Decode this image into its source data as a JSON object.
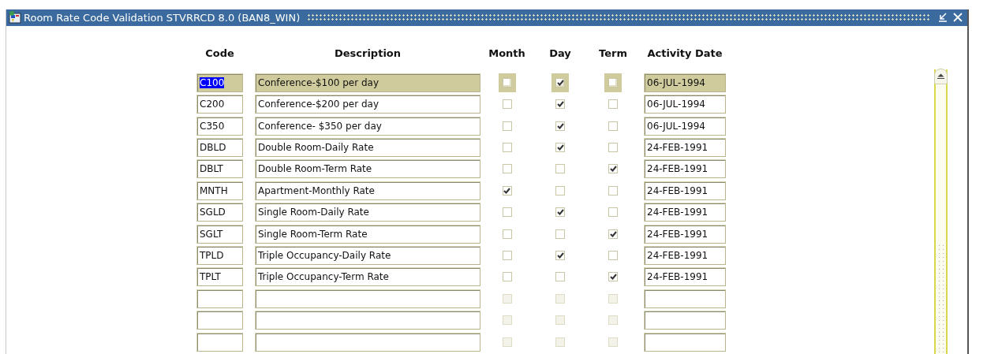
{
  "window": {
    "title": "Room Rate Code Validation  STVRRCD  8.0  (BAN8_WIN)"
  },
  "table": {
    "columns": [
      "Code",
      "Description",
      "Month",
      "Day",
      "Term",
      "Activity Date"
    ],
    "rows": [
      {
        "kind": "record",
        "selected": true,
        "code": "C100",
        "description": "Conference-$100 per day",
        "month": false,
        "day": true,
        "term": false,
        "activity_date": "06-JUL-1994"
      },
      {
        "kind": "record",
        "selected": false,
        "code": "C200",
        "description": "Conference-$200 per day",
        "month": false,
        "day": true,
        "term": false,
        "activity_date": "06-JUL-1994"
      },
      {
        "kind": "record",
        "selected": false,
        "code": "C350",
        "description": "Conference- $350 per day",
        "month": false,
        "day": true,
        "term": false,
        "activity_date": "06-JUL-1994"
      },
      {
        "kind": "record",
        "selected": false,
        "code": "DBLD",
        "description": "Double Room-Daily Rate",
        "month": false,
        "day": true,
        "term": false,
        "activity_date": "24-FEB-1991"
      },
      {
        "kind": "record",
        "selected": false,
        "code": "DBLT",
        "description": "Double Room-Term Rate",
        "month": false,
        "day": false,
        "term": true,
        "activity_date": "24-FEB-1991"
      },
      {
        "kind": "record",
        "selected": false,
        "code": "MNTH",
        "description": "Apartment-Monthly Rate",
        "month": true,
        "day": false,
        "term": false,
        "activity_date": "24-FEB-1991"
      },
      {
        "kind": "record",
        "selected": false,
        "code": "SGLD",
        "description": "Single Room-Daily Rate",
        "month": false,
        "day": true,
        "term": false,
        "activity_date": "24-FEB-1991"
      },
      {
        "kind": "record",
        "selected": false,
        "code": "SGLT",
        "description": "Single Room-Term Rate",
        "month": false,
        "day": false,
        "term": true,
        "activity_date": "24-FEB-1991"
      },
      {
        "kind": "record",
        "selected": false,
        "code": "TPLD",
        "description": "Triple Occupancy-Daily Rate",
        "month": false,
        "day": true,
        "term": false,
        "activity_date": "24-FEB-1991"
      },
      {
        "kind": "record",
        "selected": false,
        "code": "TPLT",
        "description": "Triple Occupancy-Term Rate",
        "month": false,
        "day": false,
        "term": true,
        "activity_date": "24-FEB-1991"
      },
      {
        "kind": "blank",
        "selected": false,
        "month": false,
        "day": false,
        "term": false
      },
      {
        "kind": "blank",
        "selected": false,
        "month": false,
        "day": false,
        "term": false
      },
      {
        "kind": "blank",
        "selected": false,
        "month": false,
        "day": false,
        "term": false
      }
    ]
  }
}
